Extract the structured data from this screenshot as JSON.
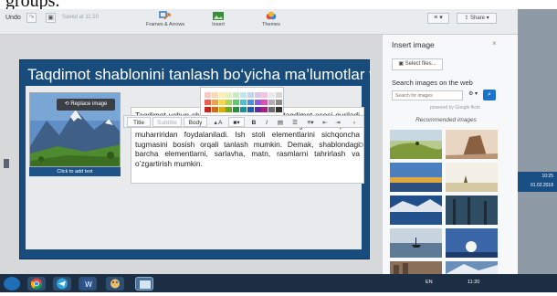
{
  "document_top_text": "groups.",
  "toolbar": {
    "undo": "Undo",
    "redo": "↷",
    "save": "▣",
    "saved": "Saved at 11:20",
    "tools": [
      {
        "label": "Frames & Arrows",
        "icon": "frames-icon"
      },
      {
        "label": "Insert",
        "icon": "insert-icon"
      },
      {
        "label": "Themes",
        "icon": "themes-icon"
      }
    ],
    "menu": "≡ ▾",
    "share": "⇪ Share ▾"
  },
  "slide": {
    "title": "Taqdimot shablonini tanlash bo‘yicha ma’lumotlar va topshiriqlar guruhi",
    "replace_image": "Replace image",
    "image_caption": "Click to add text",
    "body_text": "Taqdimot uchun shablonlarni tanlash orqali taqdimot asosi quriladi va u kerakli ma’lumotlar bilan to’ldiriladi. Buning uchun taqdimot muharriridan foydalaniladi. Ish stoli elementlarini sichqoncha tugmasini bosish orqali tanlash mumkin. Demak, shablondagi barcha elementlarni, sarlavha, matn, rasmlarni tahrirlash va o’zgartirish mumkin."
  },
  "format_bar": {
    "buttons": [
      "Title",
      "Subtitle",
      "Body",
      "▴ A",
      "■▾",
      "B",
      "I",
      "▤",
      "☰",
      "≡▾",
      "⇤",
      "⇥",
      "‹"
    ]
  },
  "palette": {
    "colors": [
      "#f7c9c2",
      "#f9d9b8",
      "#fbeeb9",
      "#e3f2bb",
      "#c7ecc4",
      "#bfe6ec",
      "#c2d5f1",
      "#d9c6ef",
      "#f1c4e3",
      "#e9e9e9",
      "#d6d6d6",
      "#ee5f4e",
      "#f4a04a",
      "#f7d74c",
      "#a7d850",
      "#5ec96d",
      "#46c3d0",
      "#4d8ee6",
      "#8a5ee0",
      "#e04fb0",
      "#b0b0b0",
      "#8c8c8c",
      "#c6241a",
      "#d46c0f",
      "#d9ae0c",
      "#6aa81f",
      "#24913b",
      "#16929e",
      "#1b5cb8",
      "#5b2cae",
      "#ac1e7e",
      "#6b6b6b",
      "#333333"
    ]
  },
  "panel": {
    "title": "Insert image",
    "close": "×",
    "select_files": "Select files...",
    "search_title": "Search images on the web",
    "search_placeholder": "Search for images",
    "search_option": "⚙ ▾",
    "search_button": "⌕",
    "powered_by": "powered by Google flickr",
    "recommended": "Recommended images"
  },
  "desktop": {
    "clock": "10:25",
    "date": "01.02.2018"
  },
  "taskbar": {
    "tray_lang": "EN",
    "tray_time": "11:20"
  }
}
